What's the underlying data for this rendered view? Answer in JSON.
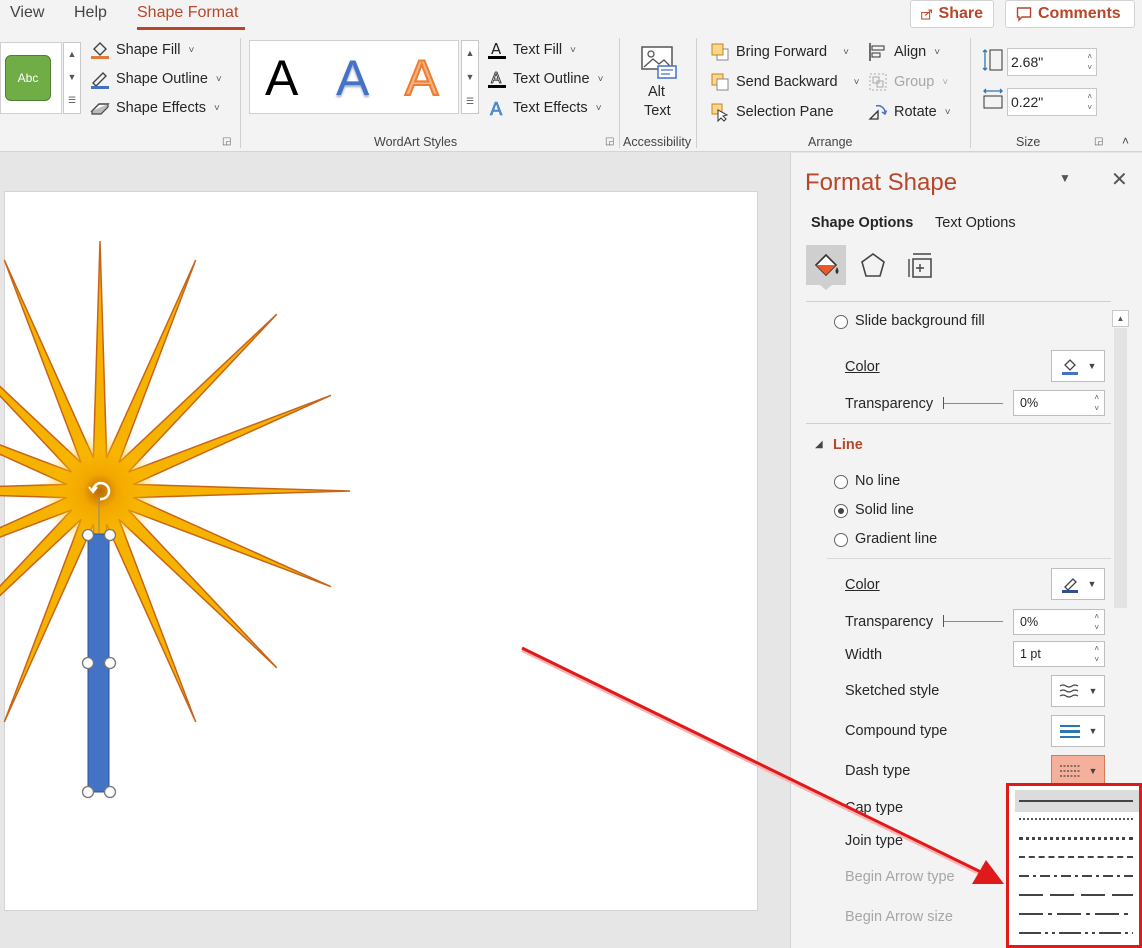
{
  "tabs": [
    {
      "label": "View",
      "active": false
    },
    {
      "label": "Help",
      "active": false
    },
    {
      "label": "Shape Format",
      "active": true
    }
  ],
  "top_buttons": {
    "share": "Share",
    "comments": "Comments"
  },
  "ribbon": {
    "shape_styles": {
      "preset_label": "Abc",
      "shape_fill": "Shape Fill",
      "shape_outline": "Shape Outline",
      "shape_effects": "Shape Effects"
    },
    "wordart": {
      "sample_letter": "A",
      "text_fill": "Text Fill",
      "text_outline": "Text Outline",
      "text_effects": "Text Effects",
      "group_label": "WordArt Styles"
    },
    "accessibility": {
      "alt_text_line1": "Alt",
      "alt_text_line2": "Text",
      "group_label": "Accessibility"
    },
    "arrange": {
      "bring_forward": "Bring Forward",
      "send_backward": "Send Backward",
      "selection_pane": "Selection Pane",
      "align": "Align",
      "group": "Group",
      "rotate": "Rotate",
      "group_label": "Arrange"
    },
    "size": {
      "height": "2.68\"",
      "width": "0.22\"",
      "group_label": "Size"
    }
  },
  "pane": {
    "title": "Format Shape",
    "tabs": {
      "shape_options": "Shape Options",
      "text_options": "Text Options"
    },
    "fill": {
      "slide_background_fill": "Slide background fill",
      "color_label": "Color",
      "transparency_label": "Transparency",
      "transparency_value": "0%"
    },
    "line": {
      "section_title": "Line",
      "no_line": "No line",
      "solid_line": "Solid line",
      "gradient_line": "Gradient line",
      "color_label": "Color",
      "transparency_label": "Transparency",
      "transparency_value": "0%",
      "width_label": "Width",
      "width_value": "1 pt",
      "sketched_style": "Sketched style",
      "compound_type": "Compound type",
      "dash_type": "Dash type",
      "cap_type": "Cap type",
      "join_type": "Join type",
      "begin_arrow_type": "Begin Arrow type",
      "begin_arrow_size": "Begin Arrow size"
    }
  },
  "colors": {
    "accent": "#b7472a",
    "sun_outer": "#f5b300",
    "sun_edge": "#c8641a",
    "shape_blue": "#4472c4",
    "highlight_red": "#e01a1a",
    "preset_green": "#70ad47"
  }
}
